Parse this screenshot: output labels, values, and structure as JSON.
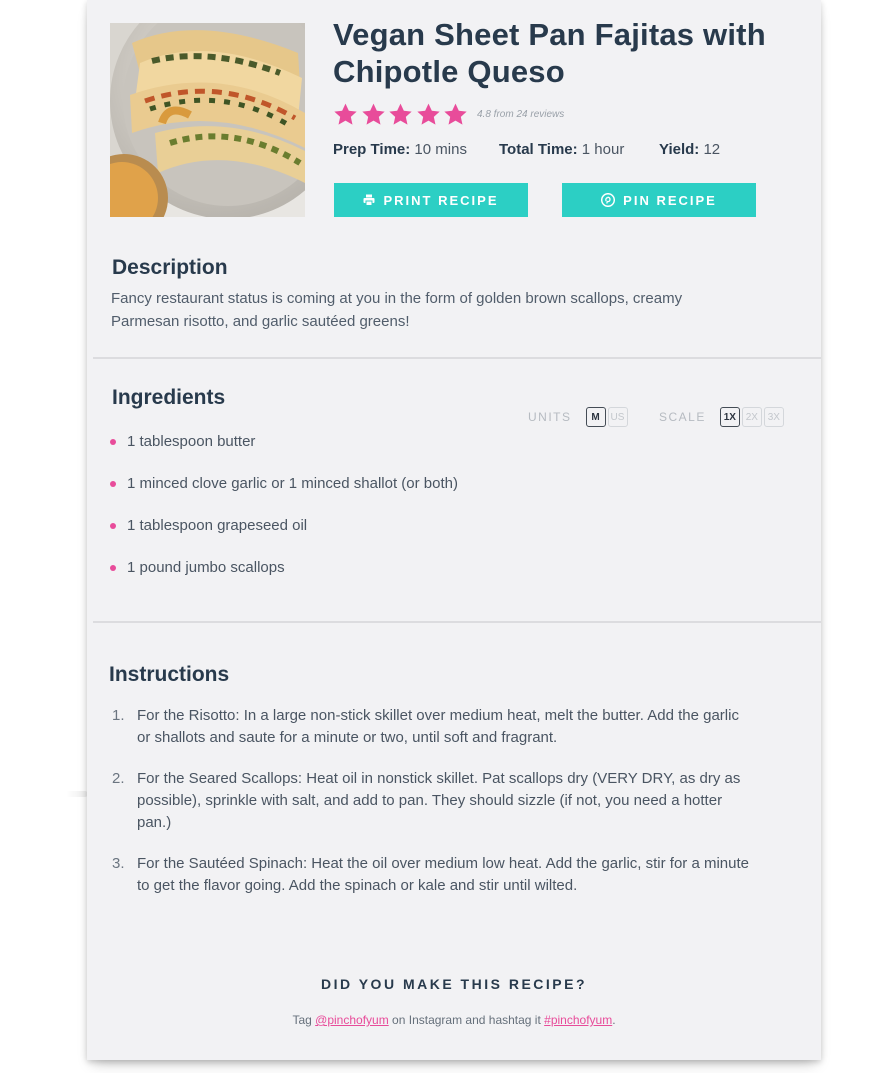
{
  "recipe": {
    "title": "Vegan Sheet Pan Fajitas with Chipotle Queso",
    "rating": {
      "value": 4.8,
      "max": 5,
      "text": "4.8 from 24 reviews",
      "star_color": "#e84c9a"
    },
    "meta": {
      "prep_label": "Prep Time:",
      "prep_value": "10 mins",
      "total_label": "Total Time:",
      "total_value": "1 hour",
      "yield_label": "Yield:",
      "yield_value": "12"
    },
    "buttons": {
      "print": "PRINT RECIPE",
      "pin": "PIN RECIPE",
      "color": "#2ccfc4"
    }
  },
  "description": {
    "heading": "Description",
    "text": "Fancy restaurant status is coming at you in the form of golden brown scallops, creamy Parmesan risotto, and garlic sautéed greens!"
  },
  "ingredients": {
    "heading": "Ingredients",
    "units_label": "UNITS",
    "units_options": [
      "M",
      "US"
    ],
    "units_selected": "M",
    "scale_label": "SCALE",
    "scale_options": [
      "1X",
      "2X",
      "3X"
    ],
    "scale_selected": "1X",
    "items": [
      "1 tablespoon butter",
      "1 minced clove garlic or 1 minced shallot (or both)",
      "1 tablespoon grapeseed oil",
      "1 pound jumbo scallops"
    ]
  },
  "instructions": {
    "heading": "Instructions",
    "steps": [
      {
        "num": "1.",
        "text": "For the Risotto: In a large non-stick skillet over medium heat, melt the butter. Add the garlic or shallots and saute for a minute or two, until soft and fragrant."
      },
      {
        "num": "2.",
        "text": "For the Seared Scallops: Heat oil in nonstick skillet. Pat scallops dry (VERY DRY, as dry as possible), sprinkle with salt, and add to pan. They should sizzle (if not, you need a hotter pan.)"
      },
      {
        "num": "3.",
        "text": "For the Sautéed Spinach: Heat the oil over medium low heat. Add the garlic, stir for a minute to get the flavor going. Add the spinach or kale and stir until wilted."
      }
    ]
  },
  "footer": {
    "cta": "DID YOU MAKE THIS RECIPE?",
    "tag_prefix": "Tag",
    "handle": "@pinchofyum",
    "tag_middle": "on Instagram and hashtag it",
    "hashtag": "#pinchofyum",
    "tag_suffix": ".",
    "link_color": "#e84c9a"
  }
}
